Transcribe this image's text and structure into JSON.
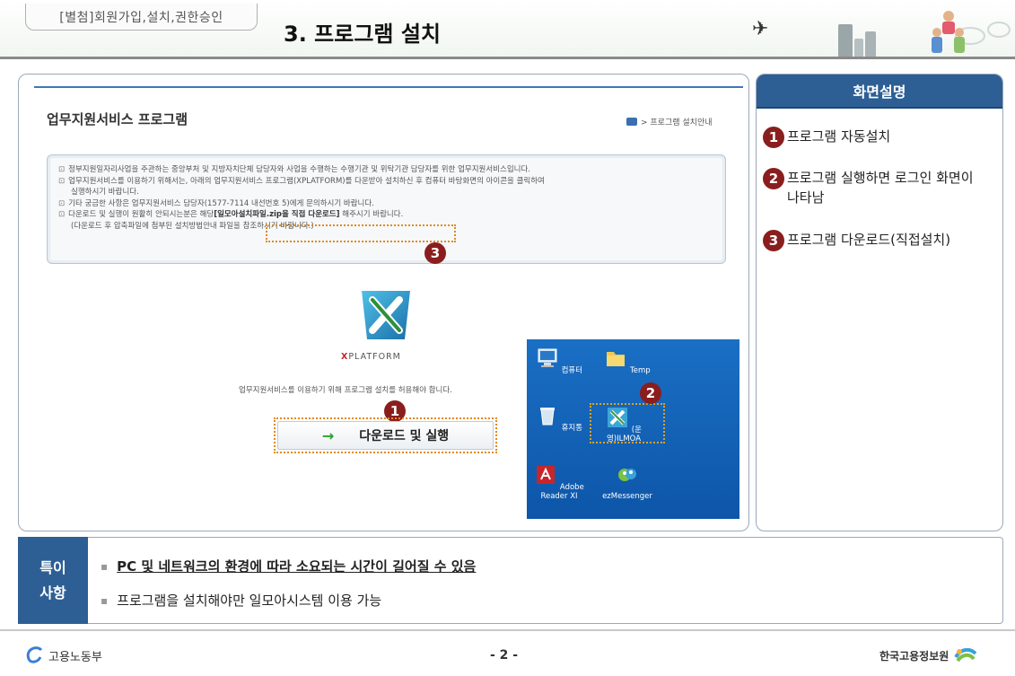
{
  "header": {
    "tab_label": "[별첨]회원가입,설치,권한승인",
    "title": "3. 프로그램 설치"
  },
  "main": {
    "page_title": "업무지원서비스 프로그램",
    "breadcrumb": "> 프로그램 설치안내",
    "info_lines": [
      "정부지원일자리사업을 주관하는 중앙부처 및 지방자치단체 담당자와 사업을 수행하는 수행기관 및 위탁기관 담당자를 위한 업무지원서비스입니다.",
      "업무지원서비스를 이용하기 위해서는, 아래의 업무지원서비스 프로그램(XPLATFORM)를 다운받아 설치하신 후 컴퓨터 바탕화면의 아이콘을 클릭하여",
      "실행하시기 바랍니다.",
      "기타 궁금한 사항은 업무지원서비스 담당자(1577-7114 내선번호 5)에게 문의하시기 바랍니다.",
      "다운로드 및 실행이 원활히 안되시는분은 해당",
      "[일모아설치파일.zip을 직접 다운로드]",
      "해주시기 바랍니다.",
      "(다운로드 후 압축파일에 첨부된 설치방법안내 파일을 참조하시기 바랍니다.)"
    ],
    "xplatform_label": "XPLATFORM",
    "allow_text": "업무지원서비스를 이용하기 위해 프로그램 설치를 허용해야 합니다.",
    "download_button": "다운로드 및 실행",
    "desktop_icons": [
      {
        "label": "컴퓨터",
        "icon": "computer-icon"
      },
      {
        "label": "Temp",
        "icon": "folder-icon"
      },
      {
        "label": "휴지통",
        "icon": "recycle-bin-icon"
      },
      {
        "label": "(운영)ILMOA",
        "icon": "ilmoa-app-icon"
      },
      {
        "label": "Adobe Reader XI",
        "icon": "adobe-reader-icon"
      },
      {
        "label": "ezMessenger",
        "icon": "messenger-icon"
      }
    ],
    "badges": [
      "1",
      "2",
      "3"
    ]
  },
  "side": {
    "header": "화면설명",
    "items": [
      {
        "num": "1",
        "text": "프로그램 자동설치"
      },
      {
        "num": "2",
        "text": "프로그램 실행하면 로그인 화면이 나타남"
      },
      {
        "num": "3",
        "text": "프로그램 다운로드(직접설치)"
      }
    ]
  },
  "notes": {
    "label_line1": "특이",
    "label_line2": "사항",
    "lines": [
      "PC 및 네트워크의 환경에 따라 소요되는 시간이 길어질 수 있음",
      "프로그램을 설치해야만 일모아시스템 이용 가능"
    ]
  },
  "footer": {
    "left": "고용노동부",
    "page": "- 2 -",
    "right": "한국고용정보원"
  },
  "colors": {
    "accent_blue": "#2d5f95",
    "badge_red": "#8a1e1e",
    "dotted_orange": "#e08a1e",
    "desktop_blue": "#1a6fc4"
  }
}
